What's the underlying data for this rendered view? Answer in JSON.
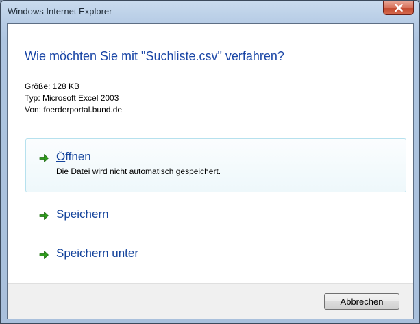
{
  "window": {
    "title": "Windows Internet Explorer"
  },
  "dialog": {
    "heading": "Wie möchten Sie mit \"Suchliste.csv\" verfahren?",
    "details": {
      "size": "Größe: 128 KB",
      "type": "Typ: Microsoft Excel 2003",
      "source": "Von: foerderportal.bund.de"
    },
    "options": [
      {
        "accesskey": "Ö",
        "label_rest": "ffnen",
        "description": "Die Datei wird nicht automatisch gespeichert.",
        "icon": "green-arrow-icon"
      },
      {
        "accesskey": "S",
        "label_rest": "peichern",
        "icon": "green-arrow-icon"
      },
      {
        "accesskey": "S",
        "label_rest": "peichern unter",
        "icon": "green-arrow-icon"
      }
    ],
    "cancel_label": "Abbrechen"
  },
  "colors": {
    "heading": "#1a46a6",
    "arrow": "#2e9c1c",
    "selected_border": "#b6e1ee",
    "close_button": "#c44b30"
  }
}
